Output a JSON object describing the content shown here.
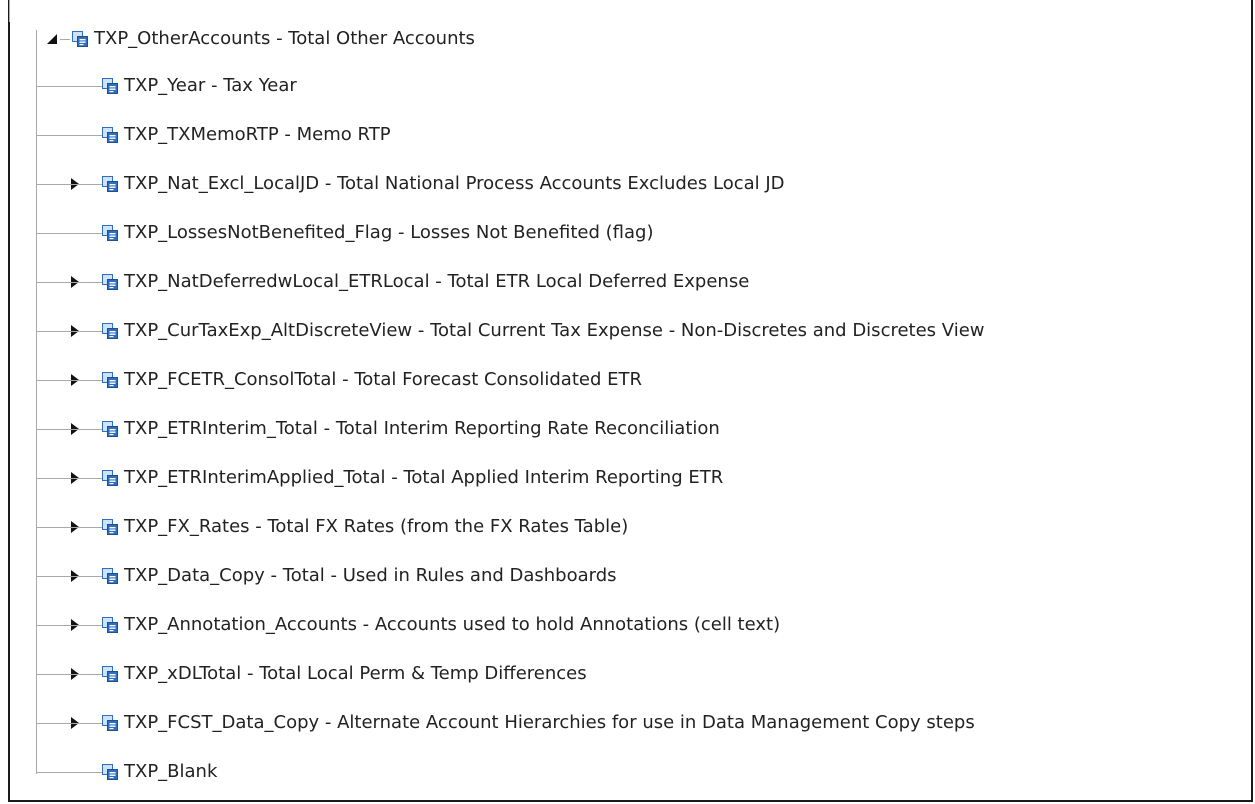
{
  "tree": {
    "root": {
      "label": "TXP_OtherAccounts - Total Other Accounts",
      "expanded": true
    },
    "children": [
      {
        "label": "TXP_Year - Tax Year",
        "has_children": false
      },
      {
        "label": "TXP_TXMemoRTP - Memo RTP",
        "has_children": false
      },
      {
        "label": "TXP_Nat_Excl_LocalJD - Total National Process Accounts Excludes Local JD",
        "has_children": true
      },
      {
        "label": "TXP_LossesNotBenefited_Flag - Losses Not Benefited (flag)",
        "has_children": false
      },
      {
        "label": "TXP_NatDeferredwLocal_ETRLocal - Total ETR Local Deferred Expense",
        "has_children": true
      },
      {
        "label": "TXP_CurTaxExp_AltDiscreteView - Total Current Tax Expense - Non-Discretes and Discretes View",
        "has_children": true
      },
      {
        "label": "TXP_FCETR_ConsolTotal - Total Forecast Consolidated ETR",
        "has_children": true
      },
      {
        "label": "TXP_ETRInterim_Total - Total Interim Reporting Rate Reconciliation",
        "has_children": true
      },
      {
        "label": "TXP_ETRInterimApplied_Total - Total Applied Interim Reporting ETR",
        "has_children": true
      },
      {
        "label": "TXP_FX_Rates - Total FX Rates (from the FX Rates Table)",
        "has_children": true
      },
      {
        "label": "TXP_Data_Copy - Total - Used in Rules and Dashboards",
        "has_children": true
      },
      {
        "label": "TXP_Annotation_Accounts - Accounts used to hold Annotations (cell text)",
        "has_children": true
      },
      {
        "label": "TXP_xDLTotal - Total Local Perm & Temp Differences",
        "has_children": true
      },
      {
        "label": "TXP_FCST_Data_Copy - Alternate Account Hierarchies for use in Data Management Copy steps",
        "has_children": true
      },
      {
        "label": "TXP_Blank",
        "has_children": false
      }
    ]
  },
  "icon": {
    "name": "account-member-icon",
    "colors": {
      "blue": "#2f6fc0",
      "light": "#cfe2f7"
    }
  }
}
